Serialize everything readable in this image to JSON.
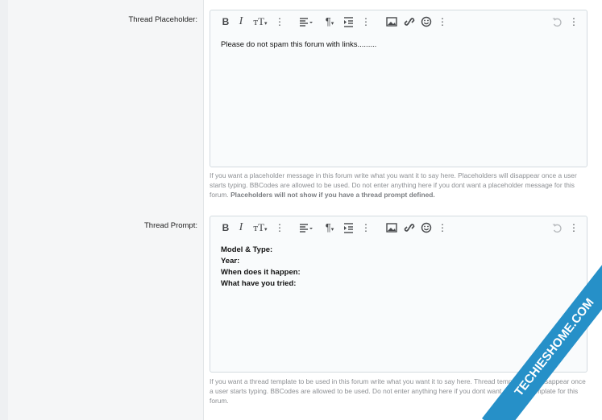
{
  "fields": [
    {
      "label": "Thread Placeholder:",
      "content_lines": [
        "Please do not spam this forum with links........."
      ],
      "hint_text": "If you want a placeholder message in this forum write what you want it to say here. Placeholders will disappear once a user starts typing. BBCodes are allowed to be used. Do not enter anything here if you dont want a placeholder message for this forum. ",
      "hint_bold": "Placeholders will not show if you have a thread prompt defined."
    },
    {
      "label": "Thread Prompt:",
      "content_lines": [
        "Model & Type:",
        "Year:",
        "When does it happen:",
        "What have you tried:"
      ],
      "hint_text": "If you want a thread template to be used in this forum write what you want it to say here. Thread templates will disappear once a user starts typing. BBCodes are allowed to be used. Do not enter anything here if you dont want a thread template for this forum."
    }
  ],
  "toolbar": {
    "bold": "B",
    "italic": "I",
    "font_size": "тT",
    "more": "⋮",
    "paragraph": "¶",
    "icons": [
      "bold-icon",
      "italic-icon",
      "font-size-icon",
      "more-text-icon",
      "align-icon",
      "paragraph-icon",
      "list-icon",
      "more-paragraph-icon",
      "image-icon",
      "link-icon",
      "emoji-icon",
      "more-insert-icon",
      "undo-icon",
      "more-misc-icon"
    ]
  },
  "watermark": "TECHIESHOME.COM",
  "colors": {
    "ribbon": "#2690c8",
    "hint": "#8c8f93"
  }
}
